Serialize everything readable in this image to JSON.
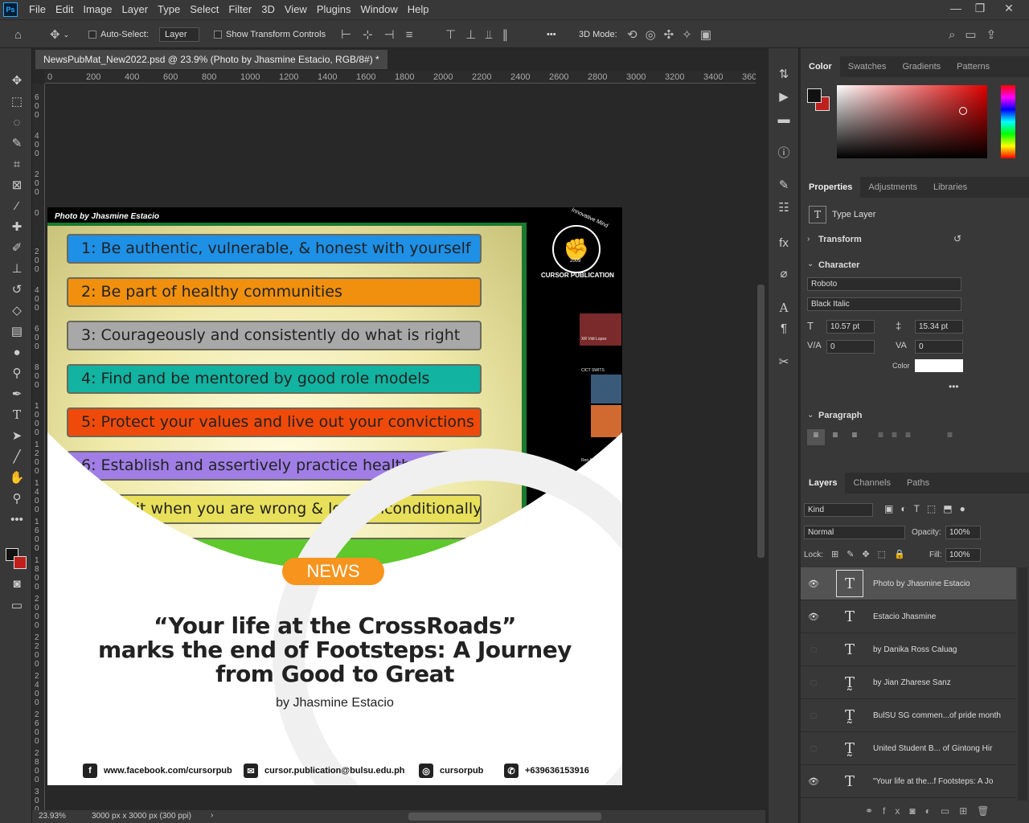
{
  "app": {
    "logo": "Ps",
    "menus": [
      "File",
      "Edit",
      "Image",
      "Layer",
      "Type",
      "Select",
      "Filter",
      "3D",
      "View",
      "Plugins",
      "Window",
      "Help"
    ],
    "win_controls": [
      "—",
      "❐",
      "✕"
    ]
  },
  "options": {
    "auto_select": "Auto-Select:",
    "layer_dropdown": "Layer",
    "show_transform": "Show Transform Controls",
    "mode_3d": "3D Mode:",
    "more": "•••"
  },
  "tab": {
    "title": "NewsPubMat_New2022.psd @ 23.9% (Photo by Jhasmine Estacio, RGB/8#) *"
  },
  "ruler": {
    "h": [
      "0",
      "200",
      "400",
      "600",
      "800",
      "1000",
      "1200",
      "1400",
      "1600",
      "1800",
      "2000",
      "2200",
      "2400",
      "2600",
      "2800",
      "3000",
      "3200",
      "3400",
      "360"
    ],
    "v": [
      "600",
      "400",
      "200",
      "0",
      "200",
      "400",
      "600",
      "800",
      "1000",
      "1200",
      "1400",
      "1600",
      "1800",
      "2000",
      "2200",
      "2400",
      "2600",
      "2800",
      "3000"
    ]
  },
  "status": {
    "zoom": "23.93%",
    "doc_size": "3000 px x 3000 px (300 ppi)"
  },
  "document": {
    "photo_credit": "Photo by Jhasmine Estacio",
    "brand": "CURSOR PUBLICATION",
    "seal_text": "Innovative Mind",
    "seal_year": "2009",
    "board_items": [
      {
        "text": "1: Be authentic, vulnerable, & honest with yourself",
        "color": "#1e90e6"
      },
      {
        "text": "2: Be part of healthy communities",
        "color": "#f0900e"
      },
      {
        "text": "3: Courageously and consistently do what is right",
        "color": "#a8a8a8"
      },
      {
        "text": "4: Find and be mentored by good role models",
        "color": "#12b3a0"
      },
      {
        "text": "5: Protect your values and live out your convictions",
        "color": "#f04a0a"
      },
      {
        "text": "6: Establish and assertively practice healthy boundaries",
        "color": "#a07ee6"
      },
      {
        "text": "7: Admit when you are wrong & love unconditionally",
        "color": "#e8e05a"
      },
      {
        "text": "",
        "color": "#5ec82c"
      }
    ],
    "video_labels": [
      "XR Vidi Lopez",
      "CICT SWITS",
      "Ren A"
    ],
    "badge": "NEWS",
    "headline": [
      "“Your life at the CrossRoads”",
      "marks the end of Footsteps: A Journey",
      "from Good to Great"
    ],
    "byline": "by Jhasmine Estacio",
    "social": [
      {
        "icon": "f",
        "text": "www.facebook.com/cursorpub"
      },
      {
        "icon": "✉",
        "text": "cursor.publication@bulsu.edu.ph"
      },
      {
        "icon": "◎",
        "text": "cursorpub"
      },
      {
        "icon": "✆",
        "text": "+639636153916"
      }
    ]
  },
  "color_panel": {
    "tabs": [
      "Color",
      "Swatches",
      "Gradients",
      "Patterns"
    ],
    "fg": "#111111",
    "bg": "#c0201c"
  },
  "properties": {
    "tabs": [
      "Properties",
      "Adjustments",
      "Libraries"
    ],
    "type_layer": "Type Layer",
    "transform": "Transform",
    "character": "Character",
    "font": "Roboto",
    "style": "Black Italic",
    "size": "10.57 pt",
    "leading": "15.34 pt",
    "kerning": "0",
    "tracking": "0",
    "color_label": "Color",
    "paragraph": "Paragraph",
    "more": "•••"
  },
  "layers_panel": {
    "tabs": [
      "Layers",
      "Channels",
      "Paths"
    ],
    "kind": "Kind",
    "blend": "Normal",
    "opacity_label": "Opacity:",
    "opacity": "100%",
    "lock_label": "Lock:",
    "fill_label": "Fill:",
    "fill": "100%",
    "layers": [
      {
        "name": "Photo by Jhasmine Estacio",
        "visible": true,
        "selected": true,
        "warn": false
      },
      {
        "name": "Estacio Jhasmine",
        "visible": true,
        "selected": false,
        "warn": false
      },
      {
        "name": "by Danika Ross Caluag",
        "visible": false,
        "selected": false,
        "warn": false
      },
      {
        "name": "by Jian Zharese Sanz",
        "visible": false,
        "selected": false,
        "warn": true
      },
      {
        "name": "BulSU SG commen...of pride month",
        "visible": false,
        "selected": false,
        "warn": true
      },
      {
        "name": "United Student B... of Gintong Hir",
        "visible": false,
        "selected": false,
        "warn": true
      },
      {
        "name": "\"Your life at the...f Footsteps: A Jo",
        "visible": true,
        "selected": false,
        "warn": false
      }
    ]
  }
}
